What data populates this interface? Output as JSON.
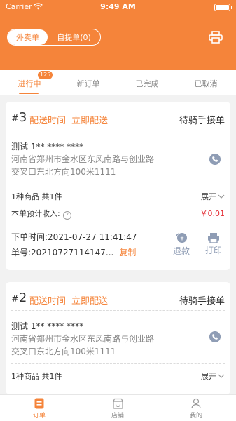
{
  "status_bar": {
    "carrier": "Carrier",
    "time": "9:49 AM"
  },
  "header": {
    "segments": [
      {
        "label": "外卖单"
      },
      {
        "label": "自提单(0)"
      }
    ]
  },
  "tabs": [
    {
      "label": "进行中",
      "badge": "125"
    },
    {
      "label": "新订单"
    },
    {
      "label": "已完成"
    },
    {
      "label": "已取消"
    }
  ],
  "orders": [
    {
      "hash": "#",
      "number": "3",
      "delivery_time_label": "配送时间",
      "delivery_now_label": "立即配送",
      "status": "待骑手接单",
      "customer": "测试 1** **** ****",
      "address_line1": "河南省郑州市金水区东风南路与创业路",
      "address_line2": "交叉口东北方向100米1111",
      "items_summary": "1种商品 共1件",
      "expand_label": "展开",
      "income_label": "本单预计收入:",
      "income_value": "￥0.01",
      "order_time": "下单时间:2021-07-27 11:41:47",
      "order_no": "单号:20210727114147...",
      "copy_label": "复制",
      "refund_label": "退款",
      "print_label": "打印"
    },
    {
      "hash": "#",
      "number": "2",
      "delivery_time_label": "配送时间",
      "delivery_now_label": "立即配送",
      "status": "待骑手接单",
      "customer": "测试 1** **** ****",
      "address_line1": "河南省郑州市金水区东风南路与创业路",
      "address_line2": "交叉口东北方向100米1111",
      "items_summary": "1种商品 共1件",
      "expand_label": "展开"
    }
  ],
  "bottom_nav": [
    {
      "label": "订单",
      "icon": "order-icon"
    },
    {
      "label": "店铺",
      "icon": "store-icon"
    },
    {
      "label": "我的",
      "icon": "user-icon"
    }
  ],
  "colors": {
    "accent": "#f5843a",
    "income": "#e5323a",
    "icon_grey": "#8f9db5"
  }
}
